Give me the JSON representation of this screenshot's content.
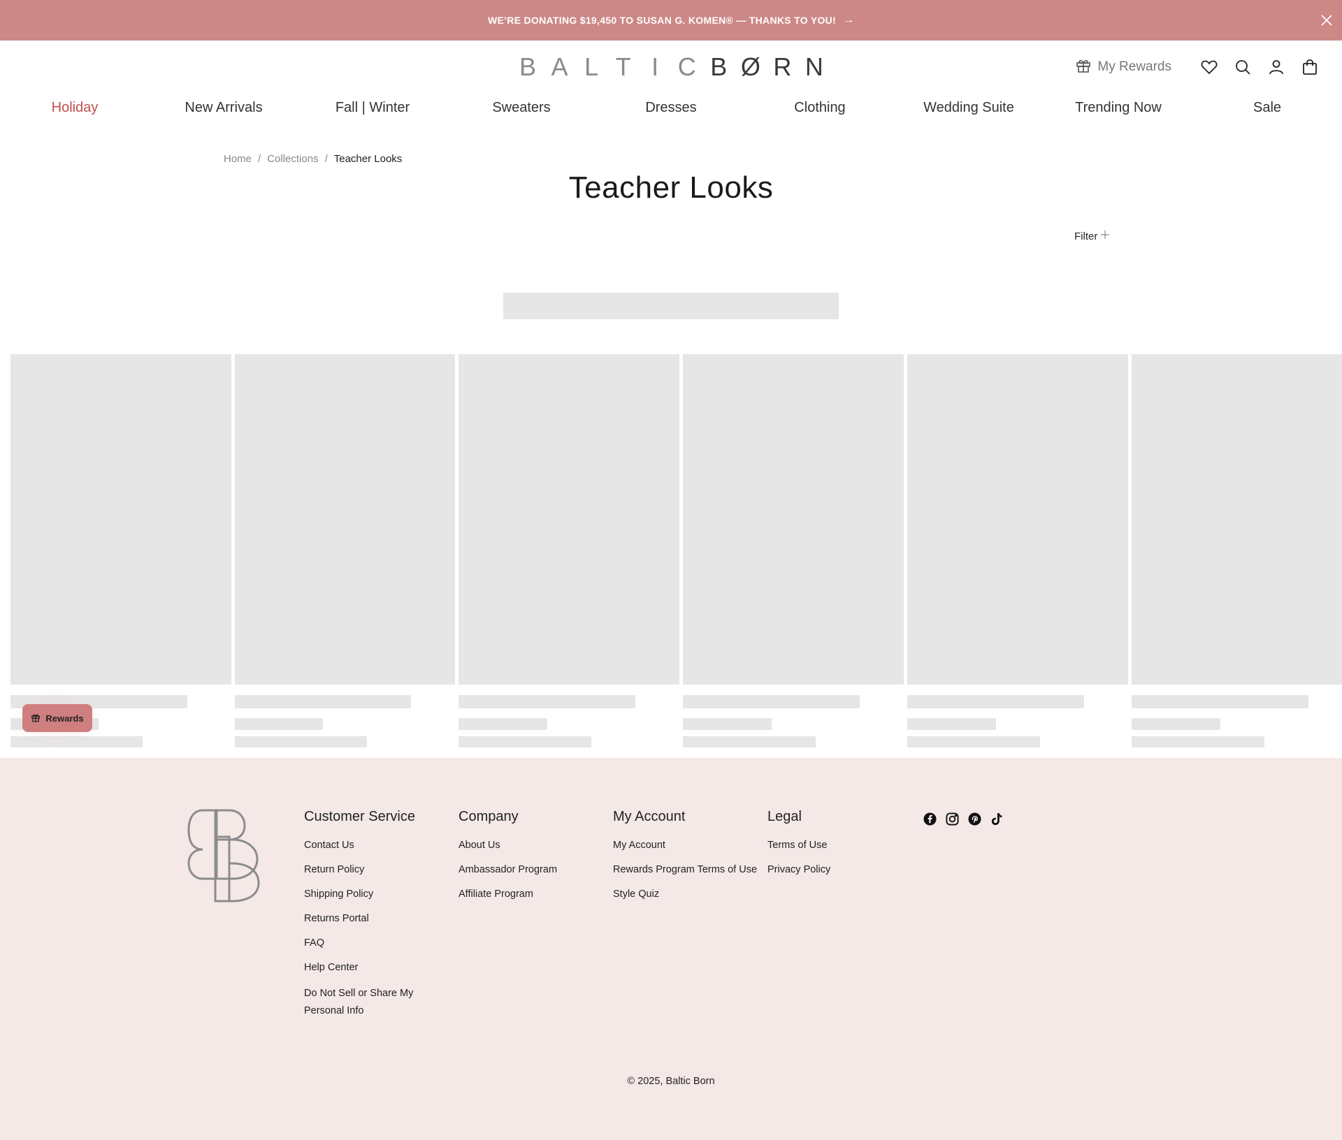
{
  "announcement": {
    "text": "WE’RE DONATING $19,450 TO SUSAN G. KOMEN® — THANKS TO YOU!",
    "arrow": "→",
    "close_icon": "close-icon"
  },
  "header": {
    "logo_light": [
      "B",
      "A",
      "L",
      "T",
      "I",
      "C"
    ],
    "logo_dark": [
      "B",
      "Ø",
      "R",
      "N"
    ],
    "rewards_label": "My Rewards",
    "icons": [
      "gift-icon",
      "heart-icon",
      "search-icon",
      "account-icon",
      "bag-icon"
    ]
  },
  "nav": {
    "items": [
      {
        "label": "Holiday",
        "active": true
      },
      {
        "label": "New Arrivals"
      },
      {
        "label": "Fall | Winter"
      },
      {
        "label": "Sweaters"
      },
      {
        "label": "Dresses"
      },
      {
        "label": "Clothing"
      },
      {
        "label": "Wedding Suite"
      },
      {
        "label": "Trending Now"
      },
      {
        "label": "Sale"
      }
    ]
  },
  "breadcrumb": {
    "home": "Home",
    "sep": "/",
    "collections": "Collections",
    "current": "Teacher Looks"
  },
  "page": {
    "title": "Teacher Looks",
    "filter_label": "Filter",
    "filter_icon": "plus-icon"
  },
  "rewards_widget": {
    "label": "Rewards"
  },
  "footer": {
    "columns": [
      {
        "heading": "Customer Service",
        "links": [
          "Contact Us",
          "Return Policy",
          "Shipping Policy",
          "Returns Portal",
          "FAQ",
          "Help Center",
          "Do Not Sell or Share My Personal Info"
        ]
      },
      {
        "heading": "Company",
        "links": [
          "About Us",
          "Ambassador Program",
          "Affiliate Program"
        ]
      },
      {
        "heading": "My Account",
        "links": [
          "My Account",
          "Rewards Program Terms of Use",
          "Style Quiz"
        ]
      },
      {
        "heading": "Legal",
        "links": [
          "Terms of Use",
          "Privacy Policy"
        ]
      }
    ],
    "socials": [
      "facebook-icon",
      "instagram-icon",
      "pinterest-icon",
      "tiktok-icon"
    ],
    "copyright": "© 2025, Baltic Born"
  },
  "colors": {
    "announcement_bg": "#cc8886",
    "active_nav": "#c0504d",
    "skeleton": "#e6e6e6",
    "footer_bg": "#f4e9e7",
    "rewards_btn": "#cf7f80"
  }
}
